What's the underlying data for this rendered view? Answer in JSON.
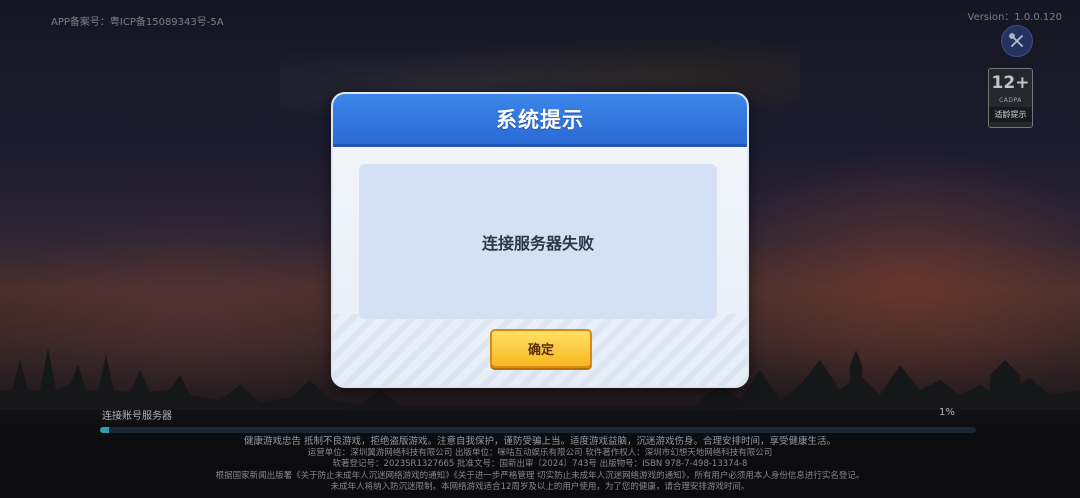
{
  "header": {
    "icp": "APP备案号：粤ICP备15089343号-5A",
    "version": "Version：1.0.0.120"
  },
  "icons": {
    "tools": "wrench-screwdriver-icon",
    "age_rating": "age-rating-badge"
  },
  "age_badge": {
    "rating": "12+",
    "org": "CADPA",
    "label": "适龄提示"
  },
  "dialog": {
    "title": "系统提示",
    "message": "连接服务器失败",
    "confirm_label": "确定"
  },
  "loading": {
    "label": "连接账号服务器",
    "percent_text": "1%",
    "progress": 0.01
  },
  "footer": {
    "line1": "健康游戏忠告 抵制不良游戏，拒绝盗版游戏。注意自我保护，谨防受骗上当。适度游戏益脑，沉迷游戏伤身。合理安排时间，享受健康生活。",
    "line2": "运营单位：深圳翼游网络科技有限公司 出版单位：咪咕互动娱乐有限公司 软件著作权人：深圳市幻想天地网络科技有限公司",
    "line3": "软著登记号：2023SR1327665 批准文号：国新出审〔2024〕743号 出版物号：ISBN 978-7-498-13374-8",
    "line4": "根据国家新闻出版署《关于防止未成年人沉迷网络游戏的通知》《关于进一步严格管理 切实防止未成年人沉迷网络游戏的通知》，所有用户必须用本人身份信息进行实名登记。",
    "line5": "未成年人将纳入防沉迷限制。本网络游戏适合12周岁及以上的用户使用，为了您的健康，请合理安排游戏时间。"
  },
  "colors": {
    "header_blue": "#2a6ad4",
    "button_yellow": "#f8b820",
    "progress_cyan": "#3ec0d8"
  }
}
